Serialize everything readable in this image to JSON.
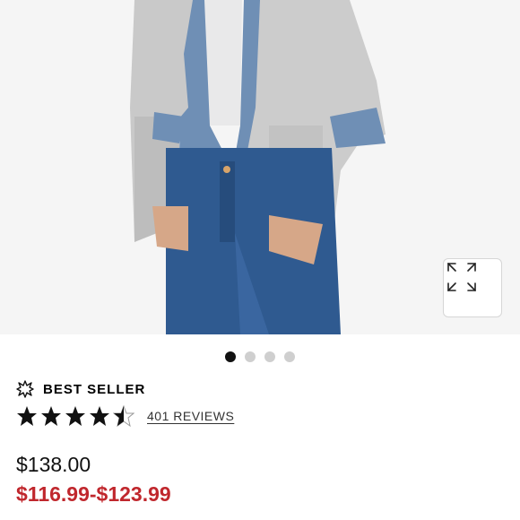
{
  "product_image": {
    "alt": "",
    "expand_icon": "expand-arrows-icon"
  },
  "carousel": {
    "dot_count": 4,
    "active_index": 0
  },
  "badge": {
    "icon": "starburst-icon",
    "label": "BEST SELLER"
  },
  "rating": {
    "stars": 4.5,
    "max": 5,
    "reviews_label": "401 REVIEWS"
  },
  "price": {
    "original": "$138.00",
    "sale": "$116.99-$123.99",
    "sale_color": "#c0272d"
  }
}
